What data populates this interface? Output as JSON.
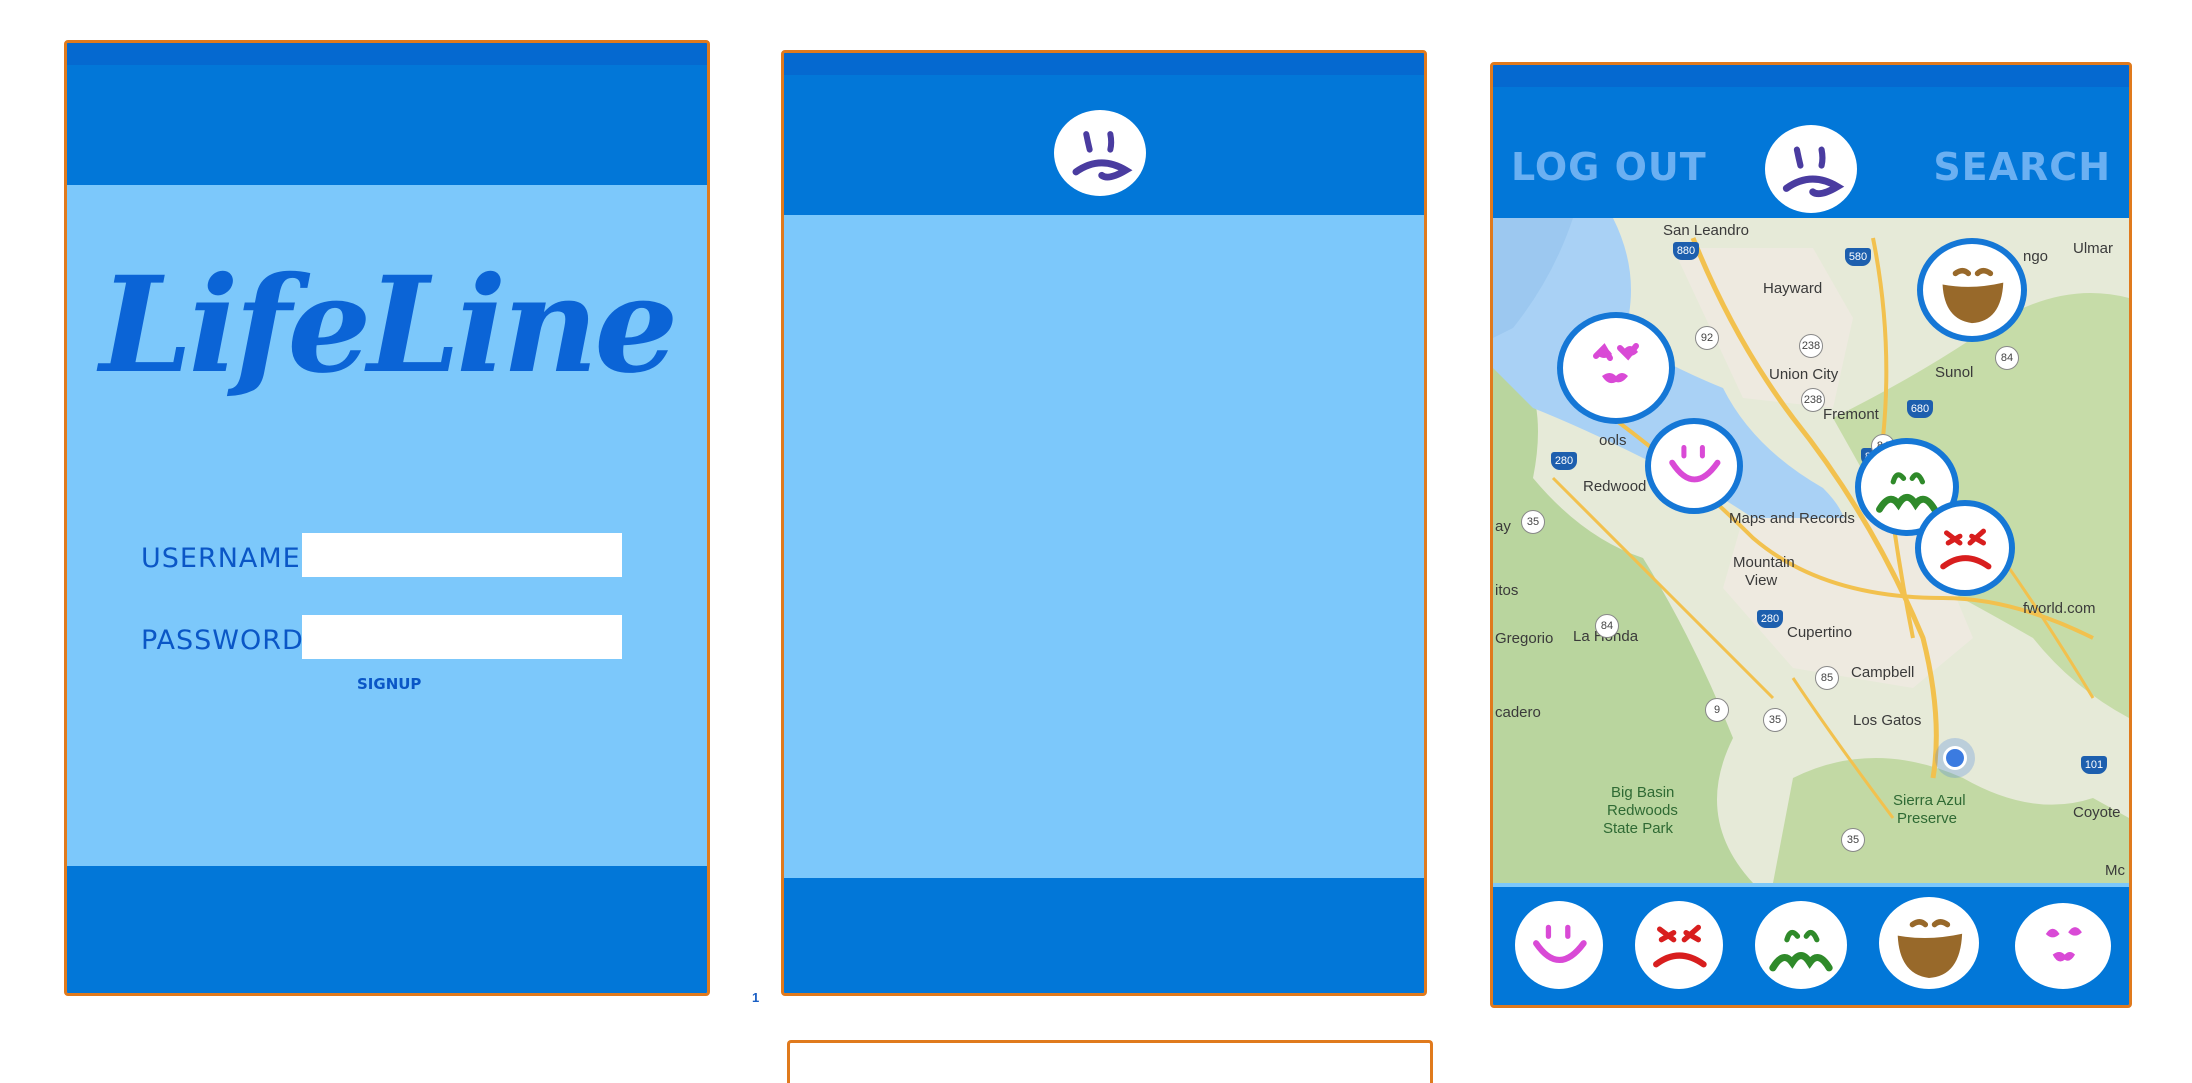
{
  "login_screen": {
    "logo": "LifeLine",
    "username_label": "USERNAME",
    "password_label": "PASSWORD",
    "signup_link": "SIGNUP",
    "username_value": "",
    "password_value": ""
  },
  "blank_screen": {
    "header_icon": "sad-face-icon"
  },
  "map_screen": {
    "logout_label": "LOG OUT",
    "search_label": "SEARCH",
    "header_icon": "sad-face-icon",
    "map_labels": [
      "San Leandro",
      "Hayward",
      "Union City",
      "Sunol",
      "Fremont",
      "Redwood City",
      "Maps and Records",
      "Mountain",
      "View",
      "Cupertino",
      "Campbell",
      "Los Gatos",
      "La Honda",
      "Big Basin",
      "Redwoods",
      "State Park",
      "Sierra Azul",
      "Preserve",
      "Coyote",
      "Ulmar",
      "ngo",
      "fworld.com",
      "ools",
      "ay",
      "itos",
      "Gregorio",
      "cadero",
      "Mc"
    ],
    "route_shields": [
      "880",
      "580",
      "92",
      "238",
      "238",
      "680",
      "84",
      "280",
      "35",
      "880",
      "84",
      "280",
      "85",
      "9",
      "35",
      "35",
      "101",
      "84"
    ],
    "map_pins": [
      "love-face-icon",
      "laughing-face-icon",
      "happy-face-icon",
      "sick-face-icon",
      "angry-face-icon"
    ],
    "mood_bar": [
      "happy-face-icon",
      "angry-face-icon",
      "sick-face-icon",
      "laughing-face-icon",
      "love-face-icon"
    ]
  },
  "page_number": "1",
  "colors": {
    "bar_blue": "#0277d8",
    "bar_top": "#0569d0",
    "screen_light": "#7cc8fb",
    "frame_orange": "#e07a1d",
    "logo_blue": "#0b64d6",
    "sad_purple": "#4a3ca0",
    "happy_pink": "#d94ad6",
    "angry_red": "#d81e1e",
    "sick_green": "#2f8a2a",
    "laugh_brown": "#98692a"
  }
}
